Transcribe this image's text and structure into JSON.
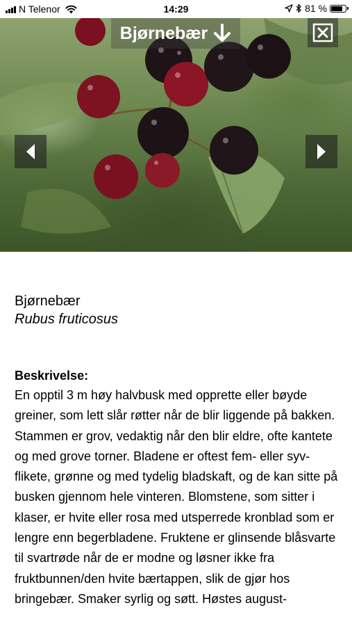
{
  "status_bar": {
    "carrier": "N Telenor",
    "time": "14:29",
    "battery_percent": "81 %",
    "battery_level": 0.81,
    "icons": [
      "signal-bars-icon",
      "wifi-icon",
      "location-arrow-icon",
      "bluetooth-icon",
      "battery-icon"
    ]
  },
  "header": {
    "title": "Bjørnebær",
    "title_icon": "arrow-down-icon",
    "close_icon": "close-box-icon"
  },
  "gallery": {
    "prev_icon": "triangle-left-icon",
    "next_icon": "triangle-right-icon"
  },
  "species": {
    "common_name": "Bjørnebær",
    "latin_name": "Rubus fruticosus"
  },
  "description": {
    "heading": "Beskrivelse:",
    "text": "En opptil 3 m høy halvbusk med opprette eller bøyde greiner, som lett slår røtter når de blir liggende på bakken. Stammen er grov, vedaktig når den blir eldre, ofte kantete og med grove torner. Bladene er oftest fem- eller syv-flikete, grønne og med tydelig bladskaft, og de kan sitte på busken gjennom hele vinteren. Blomstene, som sitter i klaser, er hvite eller rosa med utsperrede kronblad som er lengre enn begerbladene. Fruktene er glinsende blåsvarte til svartrøde når de er modne og løsner ikke fra fruktbunnen/den hvite bærtappen, slik de gjør hos bringebær. Smaker syrlig og søtt. Høstes august-"
  },
  "colors": {
    "status_bar_bg": "#ffffff",
    "overlay_bg": "#3c3c3c",
    "text": "#000000"
  }
}
